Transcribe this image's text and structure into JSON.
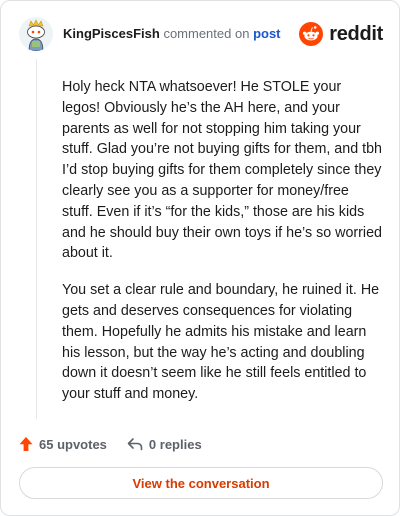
{
  "header": {
    "username": "KingPiscesFish",
    "action_text": "commented on",
    "post_link": "post",
    "brand_name": "reddit",
    "brand_color": "#ff4500",
    "avatar_icon": "snoo-avatar-icon"
  },
  "comment": {
    "paragraphs": [
      "Holy heck NTA whatsoever! He STOLE your legos! Obviously he’s the AH here, and your parents as well for not stopping him taking your stuff. Glad you’re not buying gifts for them, and tbh I’d stop buying gifts for them completely since they clearly see you as a supporter for money/free stuff. Even if it’s “for the kids,” those are his kids and he should buy their own toys if he’s so worried about it.",
      "You set a clear rule and boundary, he ruined it. He gets and deserves consequences for violating them. Hopefully he admits his mistake and learn his lesson, but the way he’s acting and doubling down it doesn’t seem like he still feels entitled to your stuff and money."
    ]
  },
  "footer": {
    "upvotes_label": "65 upvotes",
    "replies_label": "0 replies",
    "cta_label": "View the conversation",
    "upvote_color": "#ff4500",
    "upvote_icon": "upvote-arrow-icon",
    "reply_icon": "reply-arrow-icon"
  }
}
